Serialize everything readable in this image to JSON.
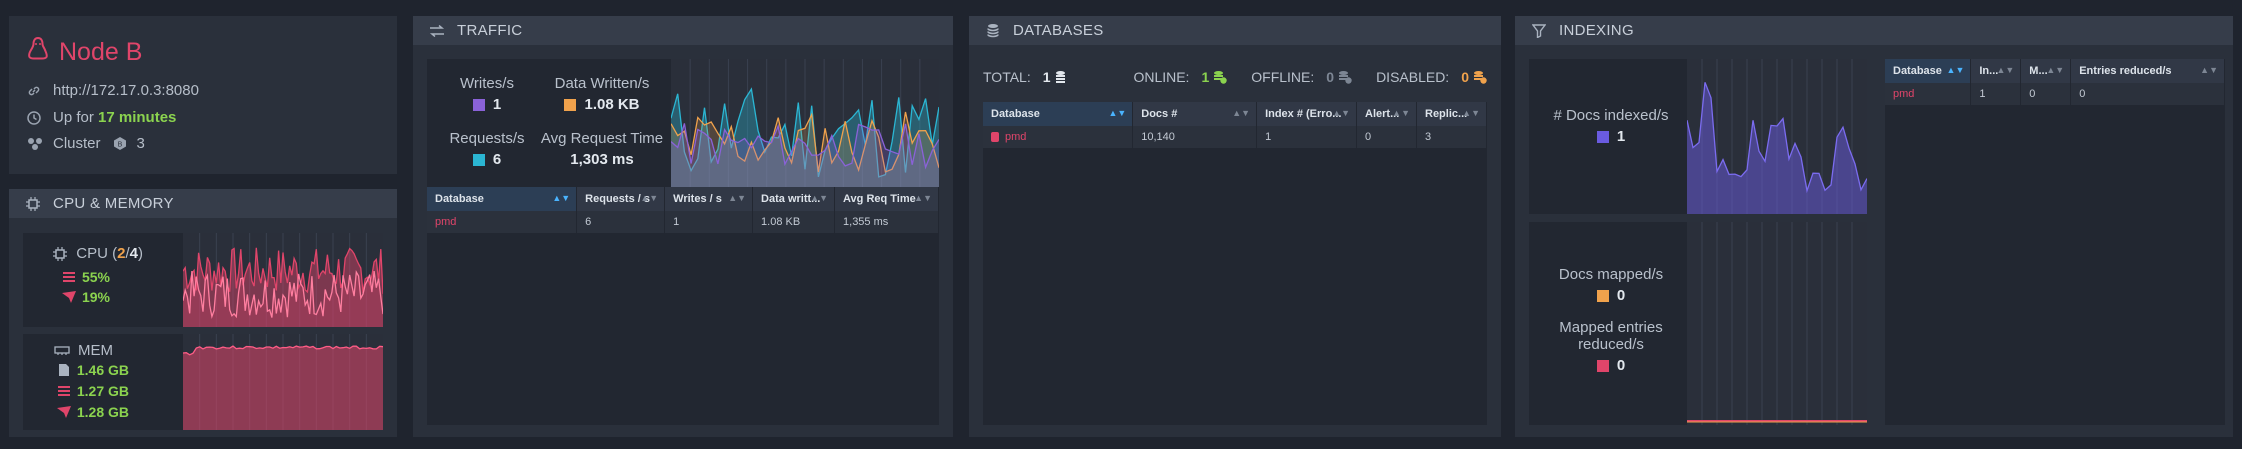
{
  "node": {
    "name": "Node B",
    "url": "http://172.17.0.3:8080",
    "uptime_prefix": "Up for",
    "uptime_value": "17 minutes",
    "cluster_label": "Cluster",
    "cluster_count": "3"
  },
  "cpu_memory": {
    "title": "CPU & MEMORY",
    "cpu_label": "CPU (",
    "cpu_used": "2",
    "cpu_sep": "/",
    "cpu_total": "4",
    "cpu_close": ")",
    "cpu_machine": "55%",
    "cpu_process": "19%",
    "mem_label": "MEM",
    "mem_total": "1.46 GB",
    "mem_machine": "1.27 GB",
    "mem_process": "1.28 GB"
  },
  "traffic": {
    "title": "TRAFFIC",
    "writes_label": "Writes/s",
    "writes_value": "1",
    "data_written_label": "Data Written/s",
    "data_written_value": "1.08 KB",
    "requests_label": "Requests/s",
    "requests_value": "6",
    "avg_time_label": "Avg Request Time",
    "avg_time_value": "1,303 ms",
    "columns": [
      "Database",
      "Requests / s",
      "Writes / s",
      "Data writt...",
      "Avg Req Time"
    ],
    "rows": [
      [
        "pmd",
        "6",
        "1",
        "1.08 KB",
        "1,355 ms"
      ]
    ]
  },
  "databases": {
    "title": "DATABASES",
    "total_label": "TOTAL:",
    "total_value": "1",
    "online_label": "ONLINE:",
    "online_value": "1",
    "offline_label": "OFFLINE:",
    "offline_value": "0",
    "disabled_label": "DISABLED:",
    "disabled_value": "0",
    "columns": [
      "Database",
      "Docs #",
      "Index # (Erro...",
      "Alert...",
      "Replic..."
    ],
    "rows": [
      [
        "pmd",
        "10,140",
        "1",
        "0",
        "3"
      ]
    ]
  },
  "indexing": {
    "title": "INDEXING",
    "docs_indexed_label": "# Docs indexed/s",
    "docs_indexed_value": "1",
    "docs_mapped_label": "Docs mapped/s",
    "docs_mapped_value": "0",
    "mapped_entries_label": "Mapped entries reduced/s",
    "mapped_entries_value": "0",
    "columns": [
      "Database",
      "In...",
      "M...",
      "Entries reduced/s"
    ],
    "rows": [
      [
        "pmd",
        "1",
        "0",
        "0"
      ]
    ]
  },
  "colors": {
    "accent_red": "#e0456a",
    "green": "#8bd34f",
    "writes": "#8a62d8",
    "data_written": "#f0a24c",
    "requests": "#2bb6d3",
    "docs_indexed": "#6a5be0",
    "docs_mapped": "#f0a24c",
    "mapped_entries": "#e0456a"
  },
  "icons": {
    "node": "linux-penguin-icon",
    "url": "link-icon",
    "uptime": "clock-icon",
    "cluster": "cluster-icon",
    "traffic": "swap-arrows-icon",
    "databases": "database-icon",
    "indexing": "filter-icon"
  }
}
